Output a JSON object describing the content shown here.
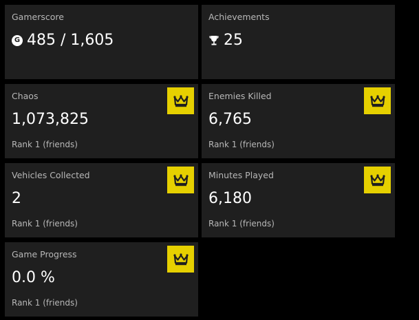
{
  "colors": {
    "background": "#000000",
    "tile": "#1f1f1f",
    "accent": "#e6d000",
    "label": "#b8b8b8",
    "value": "#ffffff"
  },
  "gamerscore": {
    "label": "Gamerscore",
    "value": "485 / 1,605",
    "icon": "gamerscore-icon"
  },
  "achievements": {
    "label": "Achievements",
    "value": "25",
    "icon": "trophy-icon"
  },
  "stats": [
    {
      "label": "Chaos",
      "value": "1,073,825",
      "rank": "Rank 1 (friends)",
      "icon": "crown-icon"
    },
    {
      "label": "Enemies Killed",
      "value": "6,765",
      "rank": "Rank 1 (friends)",
      "icon": "crown-icon"
    },
    {
      "label": "Vehicles Collected",
      "value": "2",
      "rank": "Rank 1 (friends)",
      "icon": "crown-icon"
    },
    {
      "label": "Minutes Played",
      "value": "6,180",
      "rank": "Rank 1 (friends)",
      "icon": "crown-icon"
    },
    {
      "label": "Game Progress",
      "value": "0.0 %",
      "rank": "Rank 1 (friends)",
      "icon": "crown-icon"
    }
  ]
}
